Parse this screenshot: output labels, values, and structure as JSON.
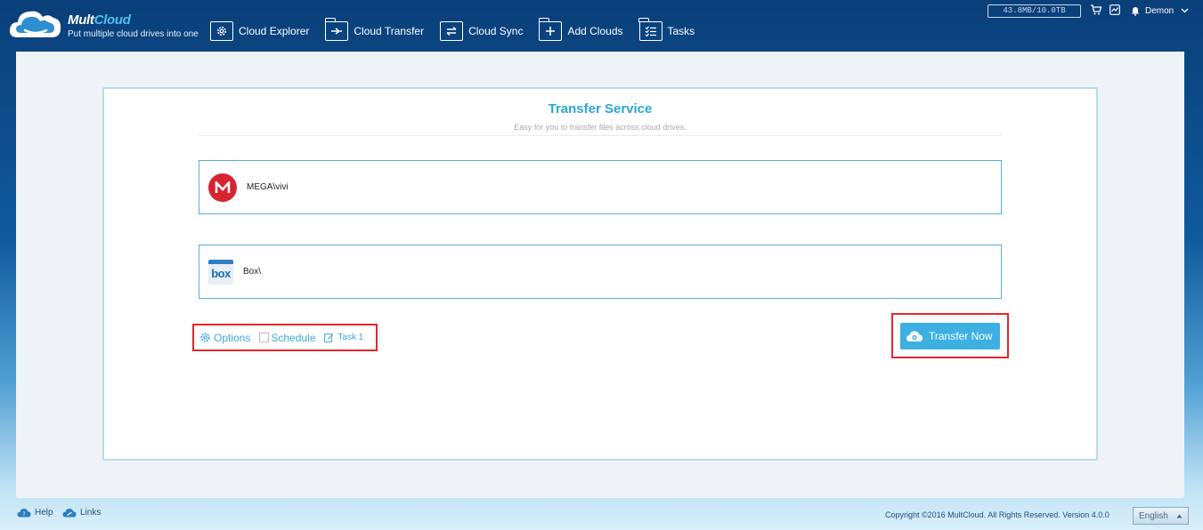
{
  "header": {
    "brand_mult": "Mult",
    "brand_cloud": "Cloud",
    "tagline": "Put multiple cloud drives into one",
    "nav": [
      {
        "label": "Cloud Explorer",
        "icon": "gear-icon"
      },
      {
        "label": "Cloud Transfer",
        "icon": "transfer-folder-icon"
      },
      {
        "label": "Cloud Sync",
        "icon": "sync-icon"
      },
      {
        "label": "Add Clouds",
        "icon": "add-folder-icon"
      },
      {
        "label": "Tasks",
        "icon": "tasks-icon"
      }
    ],
    "storage": "43.8MB/10.0TB",
    "user": "Demon"
  },
  "transfer": {
    "title": "Transfer Service",
    "subtitle": "Easy for you to transfer files across cloud drives.",
    "source": {
      "path": "MEGA\\vivi",
      "icon": "mega-logo-icon"
    },
    "target": {
      "path": "Box\\",
      "icon": "box-logo-icon"
    },
    "options_label": "Options",
    "schedule_label": "Schedule",
    "task_label": "Task 1",
    "transfer_label": "Transfer Now"
  },
  "footer": {
    "help": "Help",
    "links": "Links",
    "copyright": "Copyright ©2016 MultCloud. All Rights Reserved. Version 4.0.0",
    "language": "English"
  },
  "colors": {
    "accent": "#2aa6d5",
    "button": "#3db0e2",
    "highlight": "#e3262d",
    "mega": "#d8232e"
  }
}
